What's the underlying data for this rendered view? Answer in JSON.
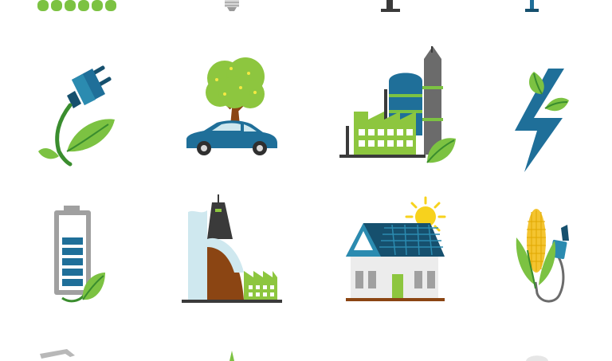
{
  "palette": {
    "green": "#8dc63f",
    "leaf_green": "#7cc242",
    "dark_green": "#3a8d2e",
    "blue": "#1f6f99",
    "navy": "#16506e",
    "teal": "#2b8bb0",
    "gray": "#6b6b6b",
    "dark_gray": "#3a3a3a",
    "light_gray": "#d9d9d9",
    "brown": "#8b4513",
    "sun_yellow": "#f7d21d",
    "corn_yellow": "#f4c430",
    "water_blue": "#cfe8ef"
  },
  "icons": [
    {
      "name": "green-leaves-row-partial-icon"
    },
    {
      "name": "light-bulb-partial-icon"
    },
    {
      "name": "pole-base-partial-icon"
    },
    {
      "name": "lamp-base-partial-icon"
    },
    {
      "name": "electric-plug-leaf-icon"
    },
    {
      "name": "car-under-tree-icon"
    },
    {
      "name": "green-factory-icon"
    },
    {
      "name": "lightning-leaf-icon"
    },
    {
      "name": "battery-leaf-icon"
    },
    {
      "name": "hydro-dam-icon"
    },
    {
      "name": "solar-house-icon"
    },
    {
      "name": "corn-fuel-pump-icon"
    },
    {
      "name": "bottom-partial-icon-left"
    },
    {
      "name": "bottom-partial-icon-middle"
    },
    {
      "name": "bottom-partial-icon-right"
    }
  ]
}
